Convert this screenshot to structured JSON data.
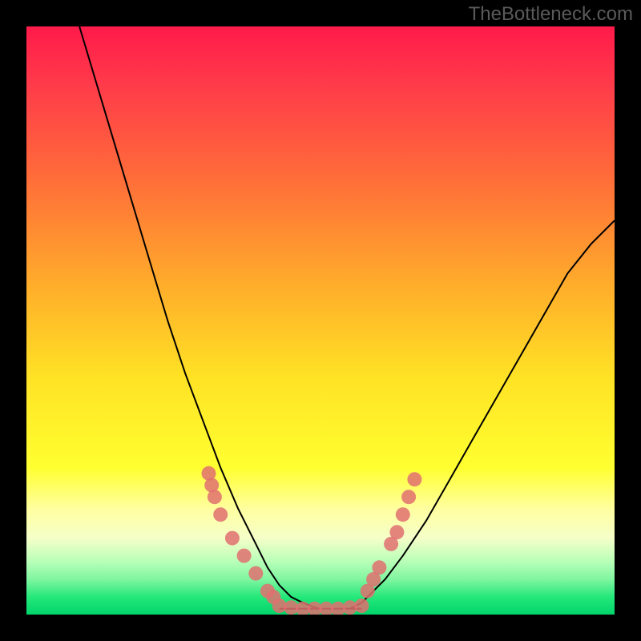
{
  "watermark": "TheBottleneck.com",
  "chart_data": {
    "type": "line",
    "title": "",
    "xlabel": "",
    "ylabel": "",
    "xlim": [
      0,
      100
    ],
    "ylim": [
      0,
      100
    ],
    "series": [
      {
        "name": "left-curve",
        "x": [
          9,
          12,
          15,
          18,
          21,
          24,
          27,
          30,
          33,
          36,
          39,
          41,
          43,
          45,
          47,
          49,
          50
        ],
        "y": [
          100,
          90,
          80,
          70,
          60,
          50,
          41,
          33,
          25,
          18,
          12,
          8,
          5,
          3,
          2,
          1.2,
          1
        ]
      },
      {
        "name": "flat-bottom",
        "x": [
          43,
          45,
          47,
          49,
          51,
          53,
          55,
          57
        ],
        "y": [
          1,
          1,
          1,
          1,
          1,
          1,
          1,
          1
        ]
      },
      {
        "name": "right-curve",
        "x": [
          55,
          57,
          59,
          61,
          64,
          68,
          72,
          76,
          80,
          84,
          88,
          92,
          96,
          100
        ],
        "y": [
          1,
          2,
          4,
          6,
          10,
          16,
          23,
          30,
          37,
          44,
          51,
          58,
          63,
          67
        ]
      }
    ],
    "dots_left": {
      "name": "left-dots",
      "color": "#e07070",
      "x": [
        31,
        31.5,
        32,
        33,
        35,
        37,
        39,
        41,
        42
      ],
      "y": [
        24,
        22,
        20,
        17,
        13,
        10,
        7,
        4,
        3
      ]
    },
    "dots_right": {
      "name": "right-dots",
      "color": "#e07070",
      "x": [
        58,
        59,
        60,
        62,
        63,
        64,
        65,
        66
      ],
      "y": [
        4,
        6,
        8,
        12,
        14,
        17,
        20,
        23
      ]
    },
    "dots_bottom": {
      "name": "bottom-dots",
      "color": "#e07070",
      "x": [
        43,
        45,
        47,
        49,
        51,
        53,
        55,
        57
      ],
      "y": [
        1.5,
        1.2,
        1,
        1,
        1,
        1,
        1.2,
        1.5
      ]
    }
  }
}
